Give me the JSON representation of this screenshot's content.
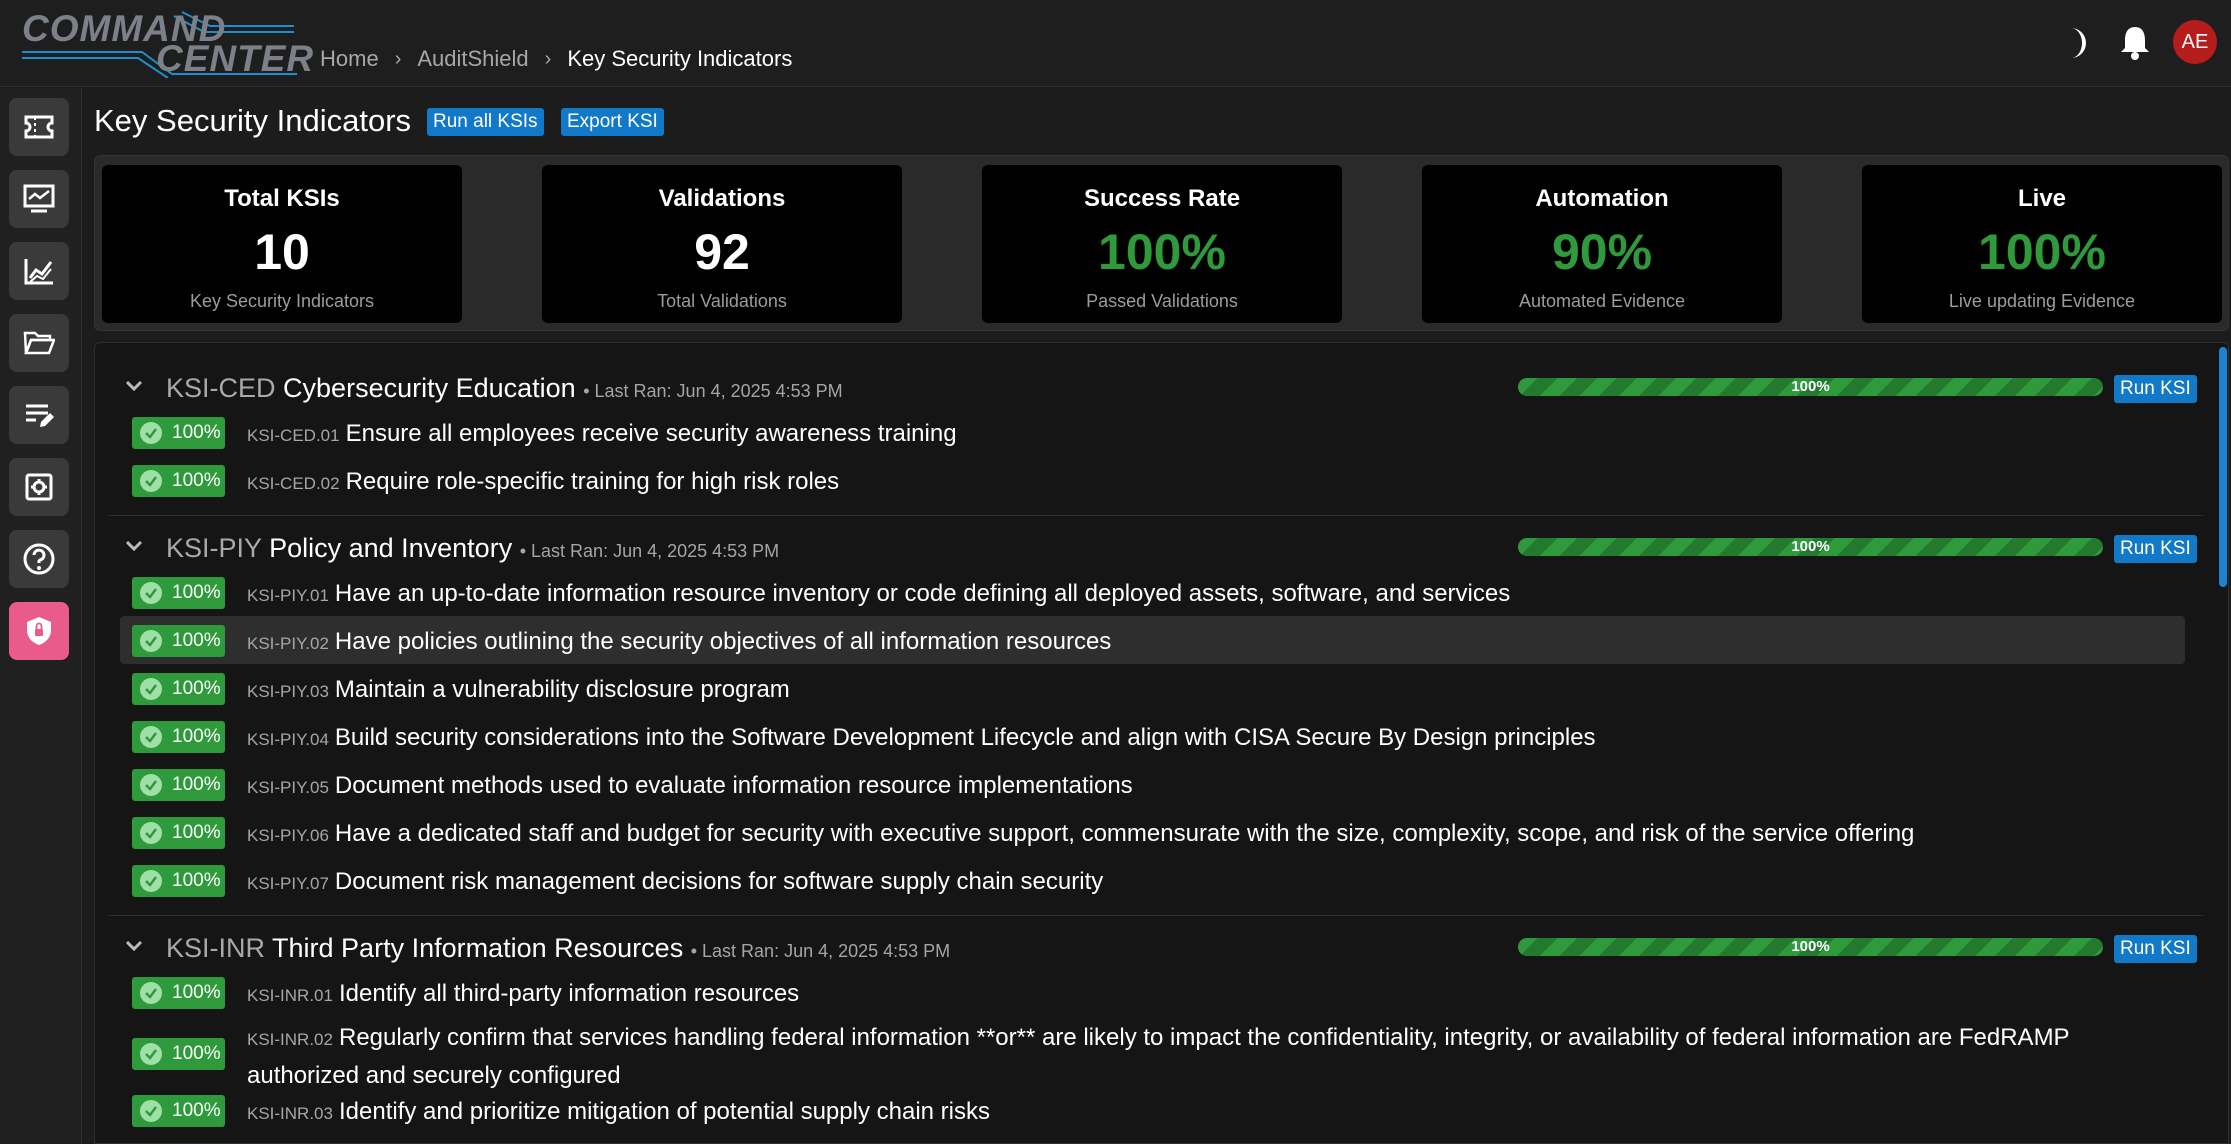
{
  "app": {
    "logo_line1": "COMMAND",
    "logo_line2": "CENTER"
  },
  "breadcrumb": [
    "Home",
    "AuditShield",
    "Key Security Indicators"
  ],
  "user": {
    "initials": "AE"
  },
  "colors": {
    "accent": "#1279c8",
    "success": "#2f9a3c",
    "active_nav": "#e85b8a",
    "avatar": "#b51c1c"
  },
  "sidebar": [
    {
      "icon": "ticket-icon"
    },
    {
      "icon": "monitor-chart-icon"
    },
    {
      "icon": "line-chart-icon"
    },
    {
      "icon": "folder-open-icon"
    },
    {
      "icon": "edit-list-icon"
    },
    {
      "icon": "settings-box-icon"
    },
    {
      "icon": "help-icon"
    },
    {
      "icon": "shield-lock-icon",
      "active": true
    }
  ],
  "header": {
    "title": "Key Security Indicators",
    "run_all_label": "Run all KSIs",
    "export_label": "Export KSI"
  },
  "stats": [
    {
      "title": "Total KSIs",
      "value": "10",
      "sub": "Key Security Indicators"
    },
    {
      "title": "Validations",
      "value": "92",
      "sub": "Total Validations"
    },
    {
      "title": "Success Rate",
      "value": "100%",
      "sub": "Passed Validations"
    },
    {
      "title": "Automation",
      "value": "90%",
      "sub": "Automated Evidence"
    },
    {
      "title": "Live",
      "value": "100%",
      "sub": "Live updating Evidence"
    }
  ],
  "groups": [
    {
      "code": "KSI-CED",
      "name": "Cybersecurity Education",
      "last_ran": "• Last Ran: Jun 4, 2025 4:53 PM",
      "progress": "100%",
      "progress_value": 1.0,
      "run_label": "Run KSI",
      "items": [
        {
          "badge": "100%",
          "code": "KSI-CED.01",
          "text": "Ensure all employees receive security awareness training"
        },
        {
          "badge": "100%",
          "code": "KSI-CED.02",
          "text": "Require role-specific training for high risk roles"
        }
      ]
    },
    {
      "code": "KSI-PIY",
      "name": "Policy and Inventory",
      "last_ran": "• Last Ran: Jun 4, 2025 4:53 PM",
      "progress": "100%",
      "progress_value": 1.0,
      "run_label": "Run KSI",
      "items": [
        {
          "badge": "100%",
          "code": "KSI-PIY.01",
          "text": "Have an up-to-date information resource inventory or code defining all deployed assets, software, and services"
        },
        {
          "badge": "100%",
          "code": "KSI-PIY.02",
          "text": "Have policies outlining the security objectives of all information resources"
        },
        {
          "badge": "100%",
          "code": "KSI-PIY.03",
          "text": "Maintain a vulnerability disclosure program"
        },
        {
          "badge": "100%",
          "code": "KSI-PIY.04",
          "text": "Build security considerations into the Software Development Lifecycle and align with CISA Secure By Design principles"
        },
        {
          "badge": "100%",
          "code": "KSI-PIY.05",
          "text": "Document methods used to evaluate information resource implementations"
        },
        {
          "badge": "100%",
          "code": "KSI-PIY.06",
          "text": "Have a dedicated staff and budget for security with executive support, commensurate with the size, complexity, scope, and risk of the service offering"
        },
        {
          "badge": "100%",
          "code": "KSI-PIY.07",
          "text": "Document risk management decisions for software supply chain security"
        }
      ]
    },
    {
      "code": "KSI-INR",
      "name": "Third Party Information Resources",
      "last_ran": "• Last Ran: Jun 4, 2025 4:53 PM",
      "progress": "100%",
      "progress_value": 1.0,
      "run_label": "Run KSI",
      "items": [
        {
          "badge": "100%",
          "code": "KSI-INR.01",
          "text": "Identify all third-party information resources"
        },
        {
          "badge": "100%",
          "code": "KSI-INR.02",
          "text": "Regularly confirm that services handling federal information **or** are likely to impact the confidentiality, integrity, or availability of federal information are FedRAMP authorized and securely configured"
        },
        {
          "badge": "100%",
          "code": "KSI-INR.03",
          "text": "Identify and prioritize mitigation of potential supply chain risks"
        }
      ]
    }
  ]
}
